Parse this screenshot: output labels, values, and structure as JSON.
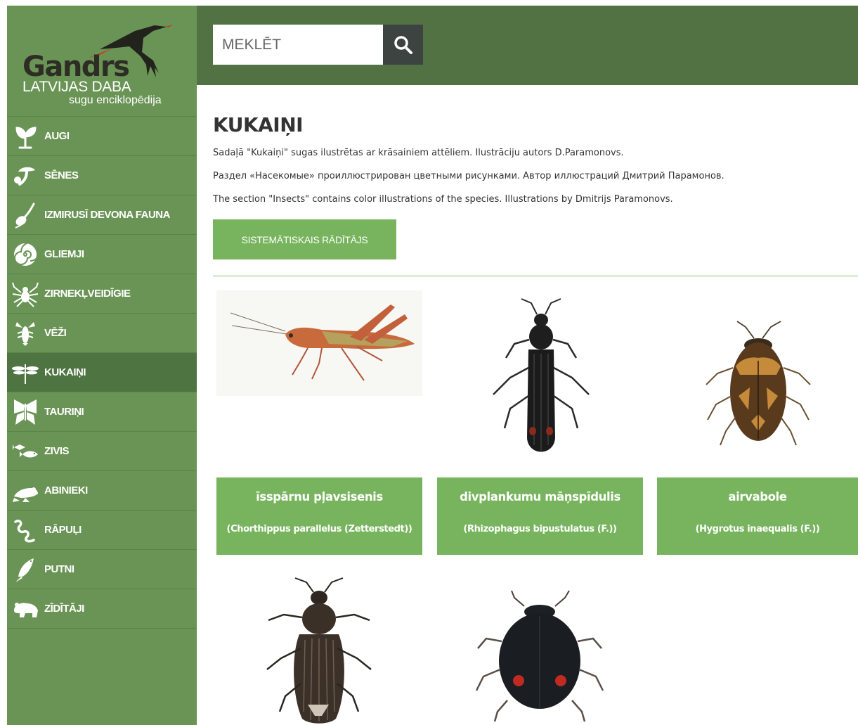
{
  "logo": {
    "brand": "Gandrs",
    "subtitle": "LATVIJAS DABA",
    "tagline": "sugu enciklopēdija"
  },
  "nav": [
    {
      "label": "AUGI",
      "icon": "plant-icon"
    },
    {
      "label": "SĒNES",
      "icon": "mushroom-icon"
    },
    {
      "label": "IZMIRUSĪ DEVONA FAUNA",
      "icon": "fossil-icon"
    },
    {
      "label": "GLIEMJI",
      "icon": "snail-shell-icon"
    },
    {
      "label": "ZIRNEKĻVEIDĪGIE",
      "icon": "spider-icon"
    },
    {
      "label": "VĒŽI",
      "icon": "crayfish-icon"
    },
    {
      "label": "KUKAIŅI",
      "icon": "dragonfly-icon",
      "active": true
    },
    {
      "label": "TAURIŅI",
      "icon": "butterfly-icon"
    },
    {
      "label": "ZIVIS",
      "icon": "fish-icon"
    },
    {
      "label": "ABINIEKI",
      "icon": "frog-icon"
    },
    {
      "label": "RĀPUĻI",
      "icon": "snake-icon"
    },
    {
      "label": "PUTNI",
      "icon": "bird-icon"
    },
    {
      "label": "ZĪDĪTĀJI",
      "icon": "bear-icon"
    }
  ],
  "search": {
    "placeholder": "MEKLĒT",
    "value": ""
  },
  "page": {
    "title": "KUKAIŅI",
    "desc_lv": "Sadaļā \"Kukaiņi\" sugas ilustrētas ar krāsainiem attēliem. Ilustrāciju autors D.Paramonovs.",
    "desc_ru": "Раздел «Насекомые» проиллюстрирован цветными рисунками. Автор иллюстраций Дмитрий Парамонов.",
    "desc_en": "The section \"Insects\" contains color illustrations of the species. Illustrations by Dmitrijs Paramonovs.",
    "index_button": "SISTEMĀTISKAIS RĀDĪTĀJS"
  },
  "species": [
    {
      "name": "īsspārnu pļavsisenis",
      "latin": "(Chorthippus parallelus (Zetterstedt))",
      "image": "grasshopper-image"
    },
    {
      "name": "divplankumu māņspīdulis",
      "latin": "(Rhizophagus bipustulatus (F.))",
      "image": "elongated-beetle-image"
    },
    {
      "name": "airvabole",
      "latin": "(Hygrotus inaequalis (F.))",
      "image": "diving-beetle-image"
    },
    {
      "name": "",
      "latin": "",
      "image": "weevil-beetle-image"
    },
    {
      "name": "",
      "latin": "",
      "image": "ladybird-beetle-image"
    }
  ],
  "colors": {
    "sidebar": "#6a9455",
    "header": "#537243",
    "accent": "#77b45d",
    "active_nav": "#4e7441"
  }
}
